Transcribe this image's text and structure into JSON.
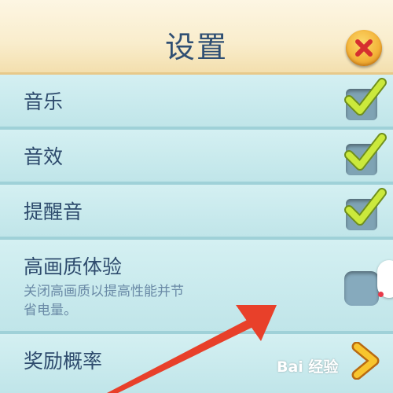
{
  "header": {
    "title": "设置"
  },
  "rows": [
    {
      "label": "音乐",
      "checked": true
    },
    {
      "label": "音效",
      "checked": true
    },
    {
      "label": "提醒音",
      "checked": true
    },
    {
      "label": "高画质体验",
      "description": "关闭高画质以提高性能并节省电量。",
      "enabled": false
    },
    {
      "label": "奖励概率"
    }
  ],
  "watermark": "Bai 经验",
  "colors": {
    "header_bg": "#f9edcc",
    "title": "#2f4f73",
    "row_bg": "#c9ebee",
    "check": "#c8e83a",
    "close_button": "#f4b43a",
    "close_x": "#d62f2f",
    "annotation_arrow": "#e8402a"
  },
  "icons": [
    "close-icon",
    "checkmark-icon",
    "chevron-right-icon"
  ]
}
